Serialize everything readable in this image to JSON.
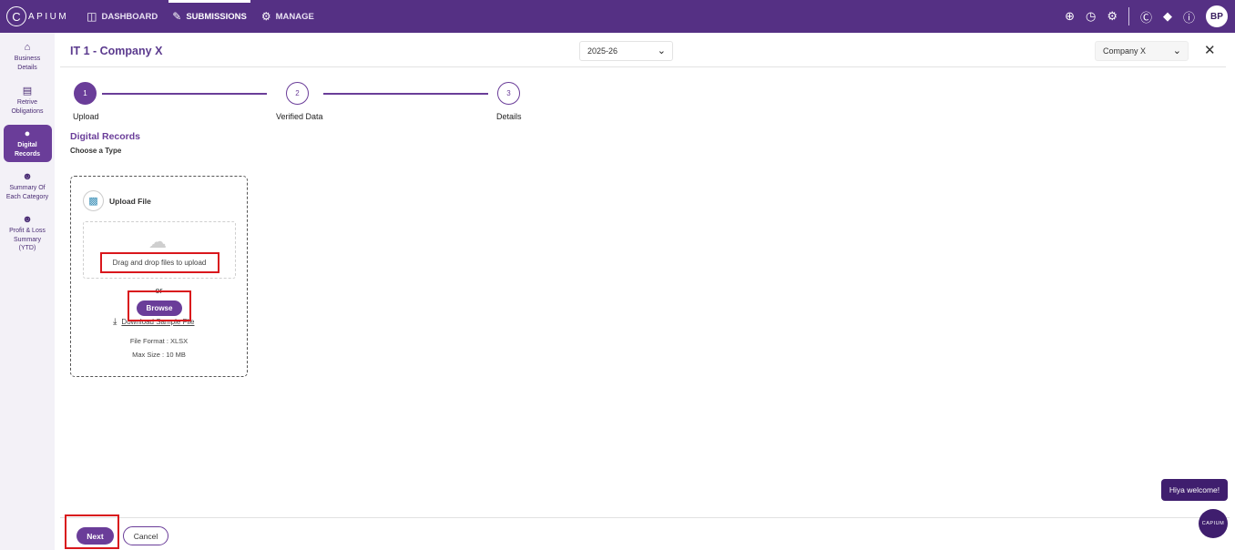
{
  "topbar": {
    "logo_text": "APIUM",
    "logo_letter": "C",
    "nav": [
      {
        "label": "DASHBOARD",
        "icon": "dashboard-icon"
      },
      {
        "label": "SUBMISSIONS",
        "icon": "pencil-icon"
      },
      {
        "label": "MANAGE",
        "icon": "manage-users-icon"
      }
    ],
    "user_initials": "BP"
  },
  "sidebar": {
    "items": [
      {
        "label": "Business Details",
        "icon": "home-icon"
      },
      {
        "label": "Retrive Obligations",
        "icon": "document-icon"
      },
      {
        "label": "Digital Records",
        "icon": "microphone-icon"
      },
      {
        "label": "Summary Of Each Category",
        "icon": "people-icon"
      },
      {
        "label": "Profit & Loss Summary (YTD)",
        "icon": "people-icon"
      }
    ]
  },
  "header": {
    "title": "IT 1 - Company X",
    "year": "2025-26",
    "company": "Company X"
  },
  "stepper": {
    "steps": [
      {
        "number": "1",
        "label": "Upload"
      },
      {
        "number": "2",
        "label": "Verified Data"
      },
      {
        "number": "3",
        "label": "Details"
      }
    ]
  },
  "section": {
    "title": "Digital Records",
    "subtitle": "Choose a Type"
  },
  "upload": {
    "title": "Upload File",
    "drop_text": "Drag and drop files to upload",
    "or_text": "or",
    "browse_label": "Browse",
    "download_label": "Download Sample File",
    "file_format": "File Format : XLSX",
    "max_size": "Max Size : 10 MB"
  },
  "footer": {
    "next_label": "Next",
    "cancel_label": "Cancel"
  },
  "chat": {
    "welcome": "Hiya welcome!",
    "launcher_text": "CAPIUM"
  },
  "colors": {
    "brand": "#553084",
    "accent": "#6a3d99",
    "highlight": "#d9171c"
  }
}
